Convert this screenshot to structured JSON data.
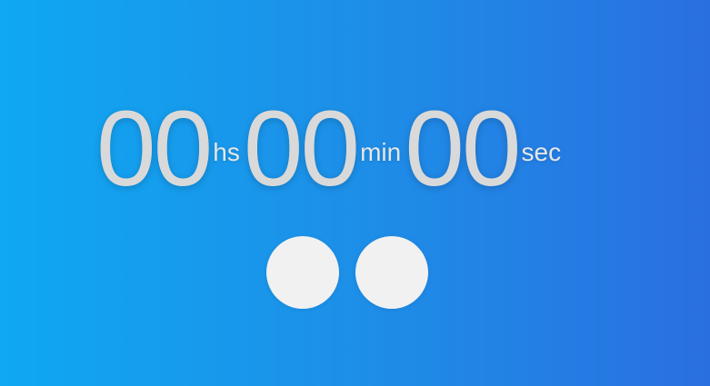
{
  "timer": {
    "hours": "00",
    "hours_label": "hs",
    "minutes": "00",
    "minutes_label": "min",
    "seconds": "00",
    "seconds_label": "sec"
  },
  "colors": {
    "background_start": "#0fa8f2",
    "background_end": "#2a6fe0",
    "digit_color": "#d9d9d9",
    "button_color": "#f1f1f1"
  },
  "controls": {
    "left_button_icon": "circle-icon",
    "right_button_icon": "circle-icon"
  }
}
